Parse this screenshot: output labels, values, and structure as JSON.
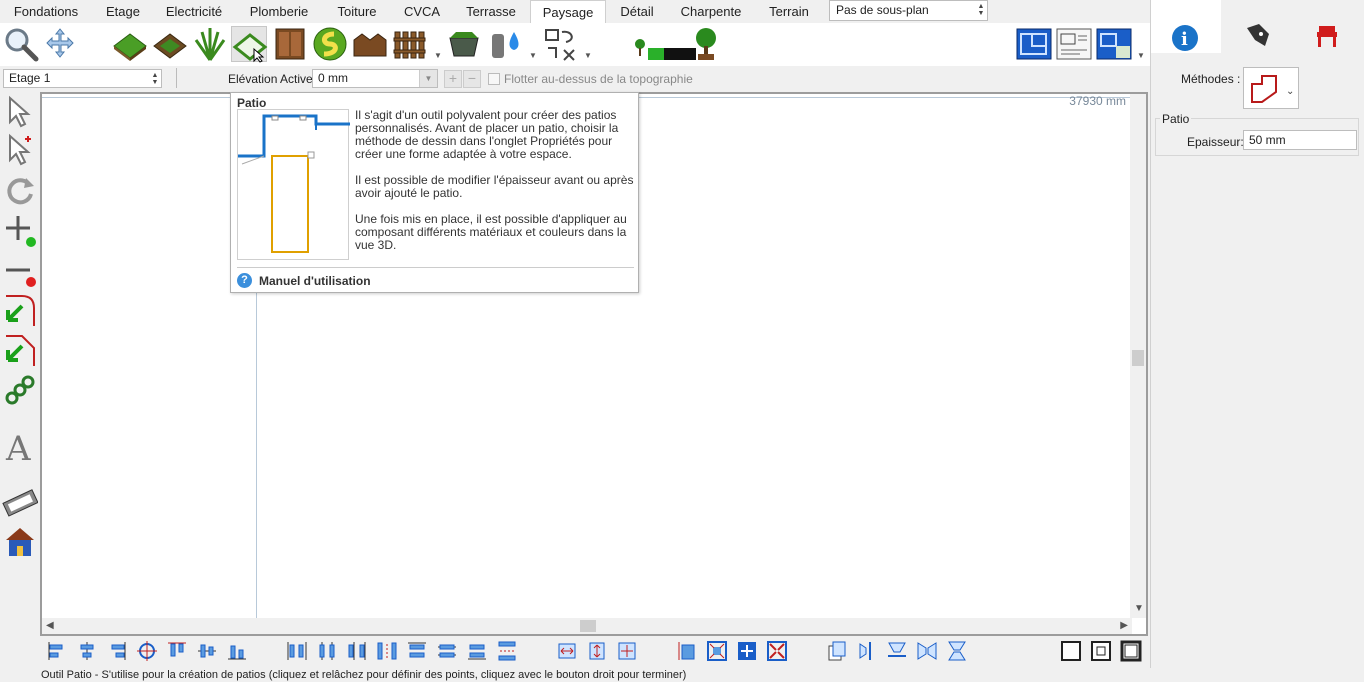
{
  "tabs": [
    "Fondations",
    "Etage",
    "Electricité",
    "Plomberie",
    "Toiture",
    "CVCA",
    "Terrasse",
    "Paysage",
    "Détail",
    "Charpente",
    "Terrain"
  ],
  "active_tab": "Paysage",
  "subplan": {
    "value": "Pas de sous-plan"
  },
  "level_bar": {
    "level": "Etage 1",
    "elevation_label": "Elévation Active:",
    "elevation_value": "0 mm",
    "float_label": "Flotter au-dessus de la topographie"
  },
  "canvas": {
    "coord": "37930 mm"
  },
  "tooltip": {
    "title": "Patio",
    "p1": "Il s'agit d'un outil polyvalent pour créer des patios personnalisés. Avant de placer un patio, choisir la méthode de dessin dans l'onglet Propriétés pour créer une forme adaptée à votre espace.",
    "p2": "Il est possible de modifier l'épaisseur avant ou après avoir ajouté le patio.",
    "p3": "Une fois mis en place, il est possible d'appliquer au composant différents matériaux et couleurs dans la vue 3D.",
    "manual": "Manuel d'utilisation"
  },
  "status": "Outil Patio - S'utilise pour la création de patios (cliquez et relâchez pour définir des points, cliquez avec le bouton droit pour terminer)",
  "right_panel": {
    "methodes_label": "Méthodes :",
    "group_title": "Patio",
    "epaisseur_label": "Epaisseur:",
    "epaisseur_value": "50 mm"
  },
  "colors": {
    "accent_blue": "#1a73c8",
    "grass_green": "#3a8a1e",
    "red": "#d01c1c"
  }
}
